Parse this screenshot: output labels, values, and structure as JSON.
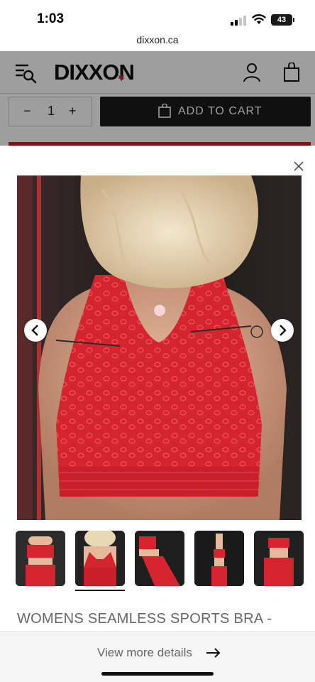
{
  "status_bar": {
    "time": "1:03",
    "battery": "43"
  },
  "browser": {
    "url": "dixxon.ca"
  },
  "header": {
    "logo_text": "DIXXON"
  },
  "purchase": {
    "minus_label": "−",
    "quantity": "1",
    "plus_label": "+",
    "add_to_cart_label": "ADD TO CART"
  },
  "gallery": {
    "image_count": 5,
    "active_index": 1,
    "accent_color": "#d42430"
  },
  "product": {
    "title": "WOMENS SEAMLESS SPORTS BRA -"
  },
  "footer": {
    "view_more_label": "View more details"
  },
  "colors": {
    "brand_dark": "#1a1a1a",
    "product_red": "#d42430"
  }
}
